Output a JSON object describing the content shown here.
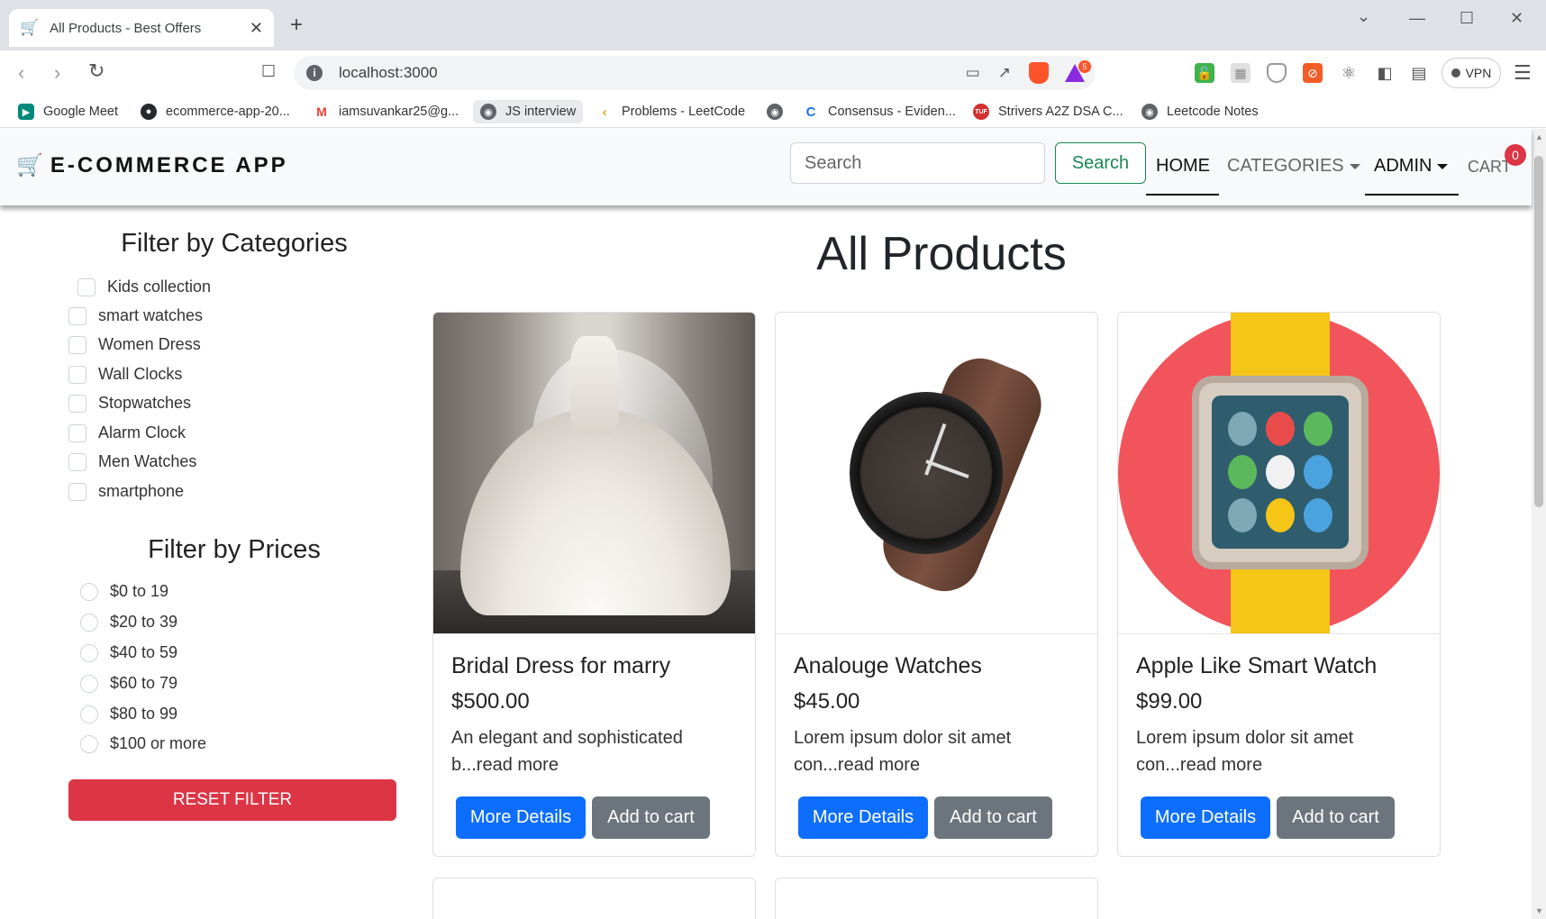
{
  "browser": {
    "tab_title": "All Products - Best Offers",
    "tab_icon": "cart-icon",
    "url": "localhost:3000",
    "rewards_badge": "5",
    "vpn_label": "VPN",
    "bookmarks": [
      {
        "label": "Google Meet",
        "icon": "google-meet-icon",
        "color": "#00897b"
      },
      {
        "label": "ecommerce-app-20...",
        "icon": "github-icon",
        "color": "#24292e"
      },
      {
        "label": "iamsuvankar25@g...",
        "icon": "gmail-icon",
        "color": "#ea4335"
      },
      {
        "label": "JS interview",
        "icon": "globe-icon",
        "color": "#5f6368"
      },
      {
        "label": "Problems - LeetCode",
        "icon": "leetcode-icon",
        "color": "#f89f1b"
      },
      {
        "label": "",
        "icon": "globe-icon",
        "color": "#5f6368"
      },
      {
        "label": "Consensus - Eviden...",
        "icon": "consensus-icon",
        "color": "#1a73e8"
      },
      {
        "label": "Strivers A2Z DSA C...",
        "icon": "tuf-icon",
        "color": "#d32f2f"
      },
      {
        "label": "Leetcode Notes",
        "icon": "globe-icon",
        "color": "#5f6368"
      }
    ]
  },
  "navbar": {
    "brand": "E-COMMERCE APP",
    "search_placeholder": "Search",
    "search_button": "Search",
    "links": {
      "home": "HOME",
      "categories": "CATEGORIES",
      "admin": "ADMIN",
      "cart": "CART"
    },
    "cart_count": "0"
  },
  "sidebar": {
    "categories_title": "Filter by Categories",
    "categories": [
      "Kids collection",
      "smart watches",
      "Women Dress",
      "Wall Clocks",
      "Stopwatches",
      "Alarm Clock",
      "Men Watches",
      "smartphone"
    ],
    "prices_title": "Filter by Prices",
    "prices": [
      "$0 to 19",
      "$20 to 39",
      "$40 to 59",
      "$60 to 79",
      "$80 to 99",
      "$100 or more"
    ],
    "reset_label": "RESET FILTER"
  },
  "main": {
    "title": "All Products",
    "products": [
      {
        "name": "Bridal Dress for marry",
        "price": "$500.00",
        "description": "An elegant and sophisticated b...read more",
        "details_label": "More Details",
        "cart_label": "Add to cart"
      },
      {
        "name": "Analouge Watches",
        "price": "$45.00",
        "description": "Lorem ipsum dolor sit amet con...read more",
        "details_label": "More Details",
        "cart_label": "Add to cart"
      },
      {
        "name": "Apple Like Smart Watch",
        "price": "$99.00",
        "description": "Lorem ipsum dolor sit amet con...read more",
        "details_label": "More Details",
        "cart_label": "Add to cart"
      }
    ]
  },
  "colors": {
    "primary": "#0d6efd",
    "secondary": "#6c757d",
    "danger": "#dc3545",
    "success": "#198754"
  }
}
